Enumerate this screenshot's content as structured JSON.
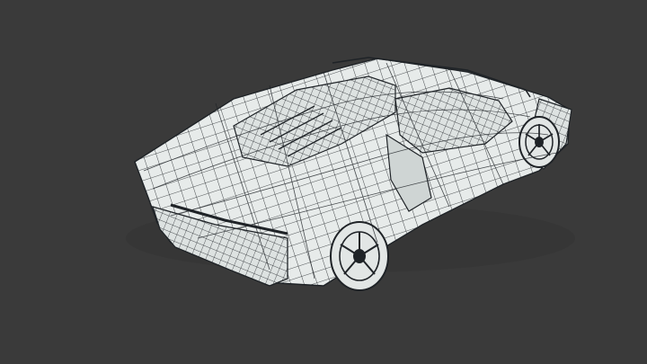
{
  "scene": {
    "background": "#3a3a3a",
    "surface": "#e7ebea",
    "wire": "#1f2327",
    "shadow": "#2f2f2f"
  }
}
